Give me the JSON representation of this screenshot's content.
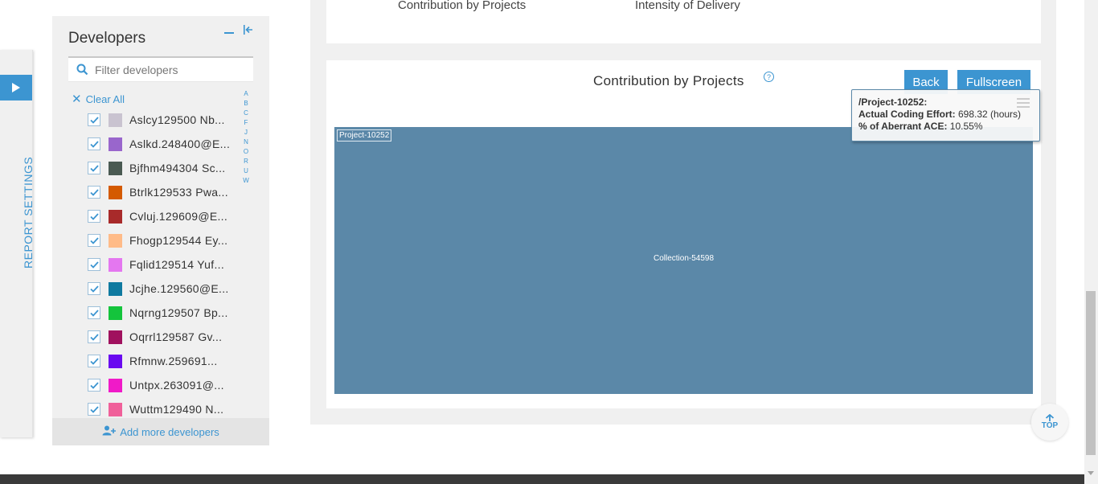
{
  "sidebar": {
    "report_settings_label": "REPORT SETTINGS"
  },
  "developers_panel": {
    "title": "Developers",
    "filter_placeholder": "Filter developers",
    "clear_all_label": "Clear All",
    "add_more_label": "Add more developers",
    "alphabet": [
      "A",
      "B",
      "C",
      "F",
      "J",
      "N",
      "O",
      "R",
      "U",
      "W"
    ],
    "items": [
      {
        "name": "Aslcy129500 Nb...",
        "color": "#c9c3d0",
        "checked": true
      },
      {
        "name": "Aslkd.248400@E...",
        "color": "#9966cc",
        "checked": true
      },
      {
        "name": "Bjfhm494304 Sc...",
        "color": "#4a5a52",
        "checked": true
      },
      {
        "name": "Btrlk129533 Pwa...",
        "color": "#d45a00",
        "checked": true
      },
      {
        "name": "Cvluj.129609@E...",
        "color": "#a82a2a",
        "checked": true
      },
      {
        "name": "Fhogp129544 Ey...",
        "color": "#ffbb88",
        "checked": true
      },
      {
        "name": "Fqlid129514 Yuf...",
        "color": "#e477f0",
        "checked": true
      },
      {
        "name": "Jcjhe.129560@E...",
        "color": "#0f7aa0",
        "checked": true
      },
      {
        "name": "Nqrng129507 Bp...",
        "color": "#14c43c",
        "checked": true
      },
      {
        "name": "Oqrrl129587 Gv...",
        "color": "#a0115e",
        "checked": true
      },
      {
        "name": "Rfmnw.259691...",
        "color": "#6a0af0",
        "checked": true
      },
      {
        "name": "Untpx.263091@...",
        "color": "#f01ac8",
        "checked": true
      },
      {
        "name": "Wuttm129490 N...",
        "color": "#f0609a",
        "checked": true
      }
    ]
  },
  "top_tabs": {
    "contribution": "Contribution by Projects",
    "intensity": "Intensity of Delivery"
  },
  "chart_card": {
    "title": "Contribution by Projects",
    "help_icon": "?",
    "back_label": "Back",
    "fullscreen_label": "Fullscreen"
  },
  "chart_data": {
    "type": "treemap",
    "title": "Contribution by Projects",
    "nodes": [
      {
        "name": "Project-10252",
        "children": [
          {
            "name": "Collection-54598",
            "color": "#5b88a8"
          }
        ]
      }
    ]
  },
  "tooltip": {
    "path": "/Project-10252:",
    "effort_label": "Actual Coding Effort",
    "effort_value": "698.32 (hours)",
    "aberrant_label": "% of Aberrant ACE",
    "aberrant_value": "10.55%"
  },
  "top_button": {
    "label": "TOP"
  },
  "colors": {
    "accent": "#3c95d1",
    "treemap_fill": "#5b88a8",
    "panel_bg": "#f0f0f0"
  }
}
